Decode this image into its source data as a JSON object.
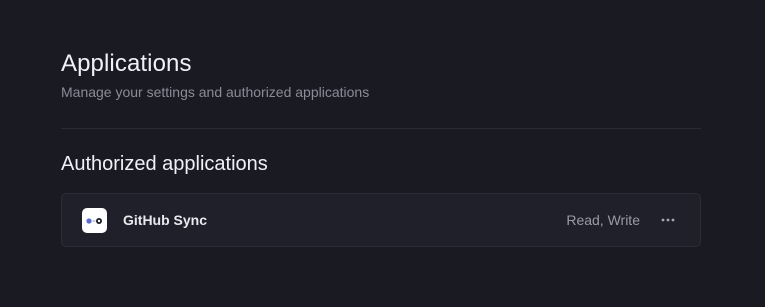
{
  "header": {
    "title": "Applications",
    "subtitle": "Manage your settings and authorized applications"
  },
  "authorized": {
    "section_title": "Authorized applications",
    "apps": [
      {
        "name": "GitHub Sync",
        "permissions": "Read, Write",
        "icon": "github-sync-logo-icon"
      }
    ]
  },
  "icons": {
    "more": "more-horizontal-icon"
  },
  "colors": {
    "background": "#1a1a23",
    "card": "#20202a",
    "border": "#2c2c37",
    "text_primary": "#f1f1f5",
    "text_secondary": "#8b8b98",
    "logo_accent": "#5b6bd8"
  }
}
